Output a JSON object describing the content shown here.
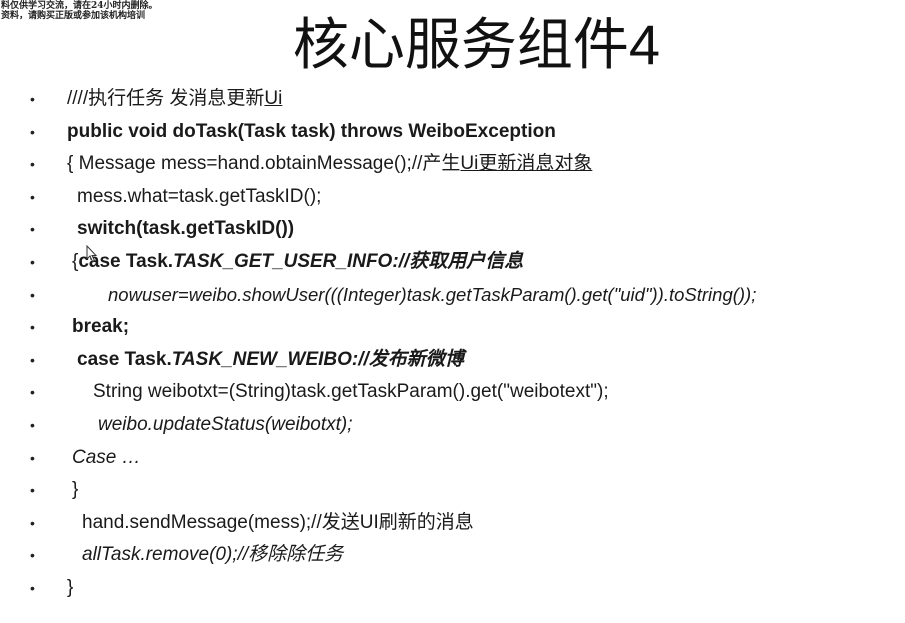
{
  "watermark": {
    "line1": "料仅供学习交流，请在24小时内删除。",
    "line2": "资料，请购买正版或参加该机构培训"
  },
  "title": {
    "main": "核心服务组件",
    "number": "4"
  },
  "lines": [
    {
      "segs": [
        "////执行任务 发消息更新",
        "Ui"
      ]
    },
    {
      "segs": [
        "public void doTask(Task task) throws WeiboException"
      ]
    },
    {
      "segs": [
        "{ Message mess=hand.obtainMessage();//产生",
        "Ui更新消息对象"
      ]
    },
    {
      "segs": [
        "mess.what=task.getTaskID();"
      ]
    },
    {
      "segs": [
        "switch(task.getTaskID())"
      ]
    },
    {
      "segs": [
        "{",
        "case Task.",
        "TASK_GET_USER_INFO://获取用户信息"
      ]
    },
    {
      "segs": [
        "nowuser=weibo.showUser(((Integer)task.getTaskParam().get(\"uid\")).toString());"
      ]
    },
    {
      "segs": [
        "break;"
      ]
    },
    {
      "segs": [
        "case Task.",
        "TASK_NEW_WEIBO://发布新微博"
      ]
    },
    {
      "segs": [
        "String weibotxt=(String)task.getTaskParam().get(\"weibotext\");"
      ]
    },
    {
      "segs": [
        "weibo.updateStatus(weibotxt);"
      ]
    },
    {
      "segs": [
        "Case …"
      ]
    },
    {
      "segs": [
        "}"
      ]
    },
    {
      "segs": [
        "hand.sendMessage(mess);//发送UI刷新的消息"
      ]
    },
    {
      "segs": [
        "allTask.remove(0);//移除除任务"
      ]
    },
    {
      "segs": [
        "}"
      ]
    }
  ],
  "bullet_char": "•"
}
